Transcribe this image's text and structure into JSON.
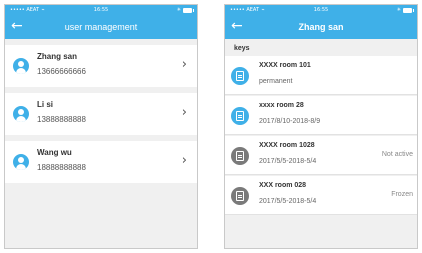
{
  "status_bar": {
    "carrier": "••••• AEAT  ⌁",
    "time": "16:55",
    "right": "✲ ✳"
  },
  "left_screen": {
    "title": "user management",
    "back_icon": "back-arrow-icon",
    "users": [
      {
        "name": "Zhang san",
        "phone": "13666666666"
      },
      {
        "name": "Li si",
        "phone": "13888888888"
      },
      {
        "name": "Wang wu",
        "phone": "18888888888"
      }
    ]
  },
  "right_screen": {
    "title": "Zhang san",
    "back_icon": "back-arrow-icon",
    "section_label": "keys",
    "keys": [
      {
        "name": "XXXX room 101",
        "period": "permanent",
        "status": "",
        "active": true
      },
      {
        "name": "xxxx room 28",
        "period": "2017/8/10-2018-8/9",
        "status": "",
        "active": true
      },
      {
        "name": "XXXX room 1028",
        "period": "2017/5/5-2018-5/4",
        "status": "Not active",
        "active": false
      },
      {
        "name": "XXX room 028",
        "period": "2017/5/5-2018-5/4",
        "status": "Frozen",
        "active": false
      }
    ]
  },
  "colors": {
    "accent": "#3fb0e8",
    "background": "#f0f0f0",
    "inactive": "#7a7a7a"
  }
}
